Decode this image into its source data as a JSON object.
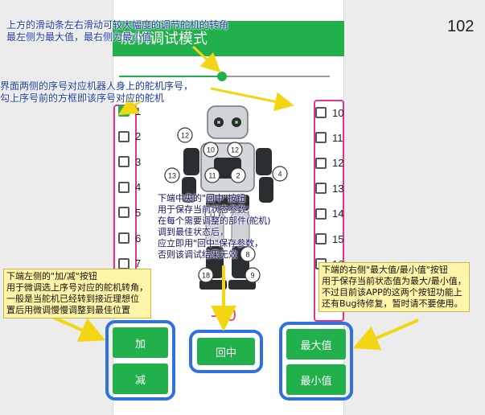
{
  "page_number": "102",
  "app": {
    "title": "舵机调试模式",
    "primary_color": "#21b04c",
    "value_color": "#e14a4a"
  },
  "slider": {
    "position_fraction": 0.49
  },
  "left_servos": [
    {
      "label": "1",
      "checked": true
    },
    {
      "label": "2",
      "checked": false
    },
    {
      "label": "3",
      "checked": false
    },
    {
      "label": "4",
      "checked": false
    },
    {
      "label": "5",
      "checked": false
    },
    {
      "label": "6",
      "checked": false
    },
    {
      "label": "7",
      "checked": false
    }
  ],
  "right_servos": [
    {
      "label": "10",
      "checked": false
    },
    {
      "label": "11",
      "checked": false
    },
    {
      "label": "12",
      "checked": false
    },
    {
      "label": "13",
      "checked": false
    },
    {
      "label": "14",
      "checked": false
    },
    {
      "label": "15",
      "checked": false
    },
    {
      "label": "16",
      "checked": false
    }
  ],
  "robot_markers": [
    "12",
    "10",
    "11",
    "2",
    "13",
    "11",
    "4",
    "18",
    "9",
    "8",
    "12"
  ],
  "value_display": "-40",
  "buttons": {
    "add": "加",
    "subtract": "减",
    "center": "回中",
    "max": "最大值",
    "min": "最小值"
  },
  "annotations": {
    "slider_note": [
      "上方的滑动条左右滑动可较大幅度的调节舵机的转角",
      "最左侧为最大值，最右侧为最小值"
    ],
    "checkbox_note": [
      "界面两侧的序号对应机器人身上的舵机序号，",
      "勾上序号前的方框即该序号对应的舵机"
    ],
    "center_note": [
      "下端中央的\"回中\"按钮",
      "用于保存当前状态参数：",
      "在每个需要调整的部件(舵机)",
      "调到最佳状态后，",
      "应立即用\"回中\"保存参数，",
      "否则该调试结果无效"
    ],
    "add_sub_note": [
      "下端左侧的\"加/减\"按钮",
      "用于微调选上序号对应的舵机转角，",
      "一般是当舵机已经转到接近理想位",
      "置后用微调慢慢调整到最佳位置"
    ],
    "maxmin_note": [
      "下端的右侧\"最大值/最小值\"按钮",
      "用于保存当前状态值为最大/最小值，",
      "不过目前该APP的这两个按钮功能上",
      "还有Bug待修复，暂时请不要使用。"
    ]
  },
  "colors": {
    "annotation_text": "#1a3a9e",
    "group_outline": "#2f72de",
    "checkbox_frame": "#e0358a",
    "arrow": "#f2d614"
  }
}
